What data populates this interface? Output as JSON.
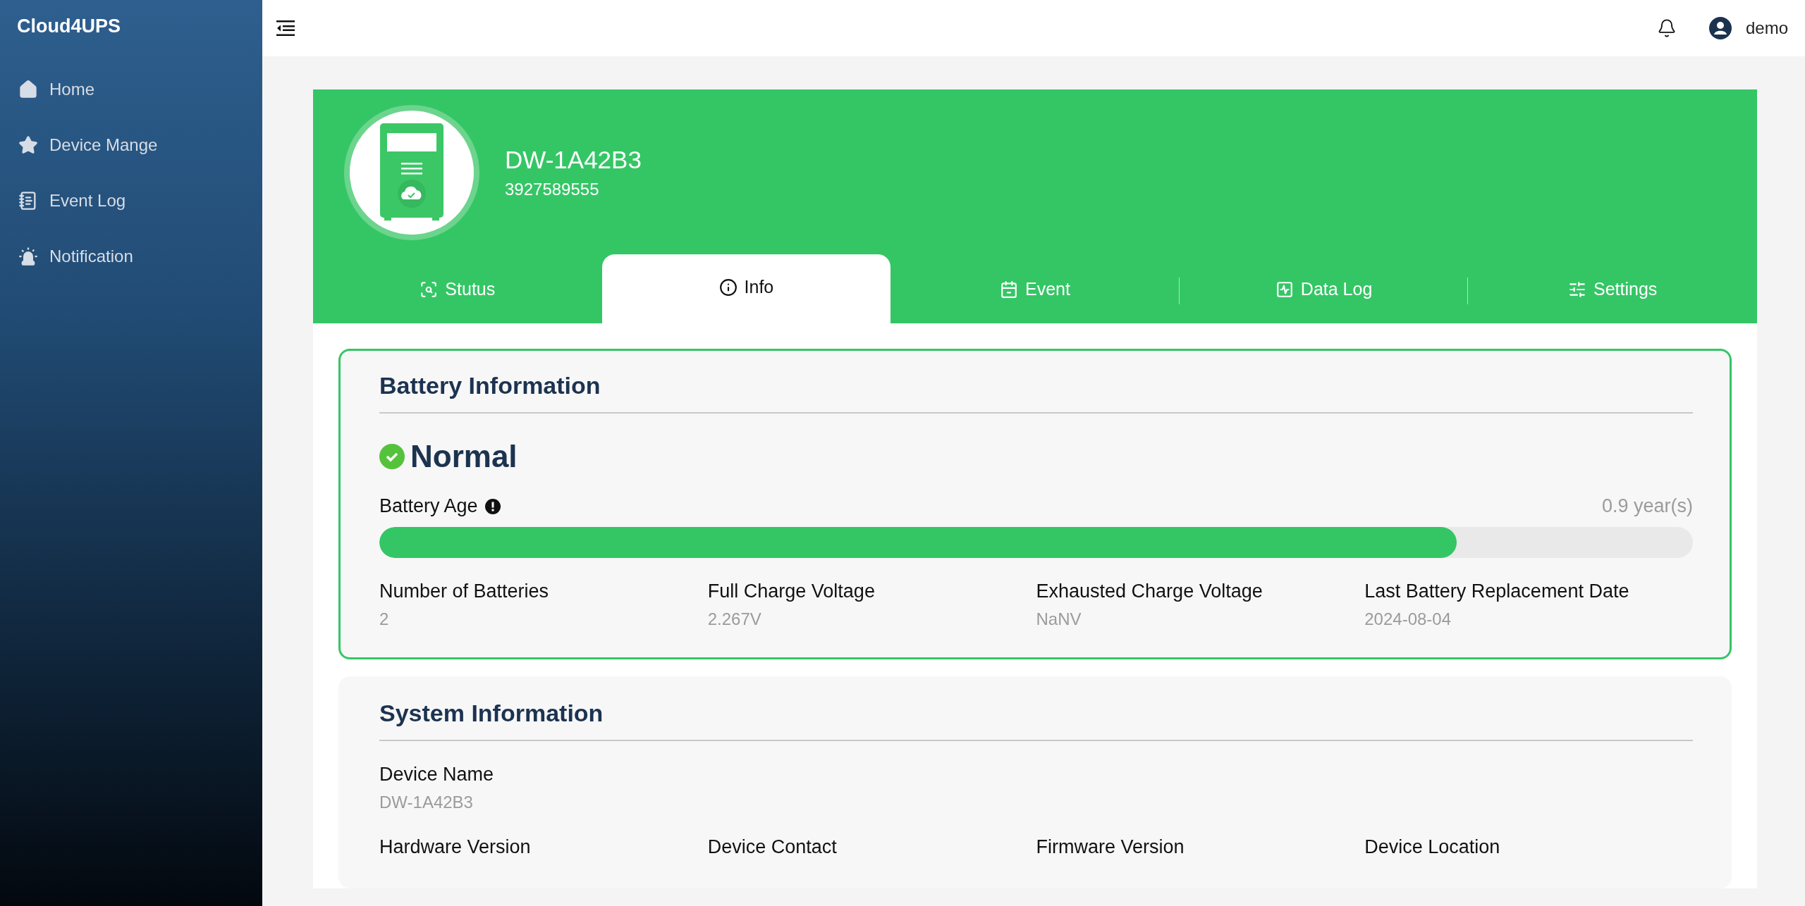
{
  "sidebar": {
    "brand": "Cloud4UPS",
    "items": [
      {
        "label": "Home",
        "kind": "home"
      },
      {
        "label": "Device Mange",
        "kind": "star"
      },
      {
        "label": "Event Log",
        "kind": "notepad"
      },
      {
        "label": "Notification",
        "kind": "alarm"
      }
    ]
  },
  "header": {
    "user": "demo"
  },
  "device": {
    "name": "DW-1A42B3",
    "serial": "3927589555"
  },
  "tabs": [
    {
      "label": "Stutus",
      "kind": "status",
      "selected": false
    },
    {
      "label": "Info",
      "kind": "info",
      "selected": true
    },
    {
      "label": "Event",
      "kind": "event",
      "selected": false
    },
    {
      "label": "Data Log",
      "kind": "chart",
      "selected": false
    },
    {
      "label": "Settings",
      "kind": "sliders",
      "selected": false
    }
  ],
  "battery": {
    "title": "Battery Information",
    "status": "Normal",
    "age_label": "Battery Age",
    "age_value": "0.9 year(s)",
    "level": 0.82,
    "fields": [
      {
        "label": "Number of Batteries",
        "value": "2"
      },
      {
        "label": "Full Charge Voltage",
        "value": "2.267V"
      },
      {
        "label": "Exhausted Charge Voltage",
        "value": "NaNV"
      },
      {
        "label": "Last Battery Replacement Date",
        "value": "2024-08-04"
      }
    ]
  },
  "system": {
    "title": "System Information",
    "rows": [
      [
        {
          "label": "Device Name",
          "value": "DW-1A42B3"
        }
      ],
      [
        {
          "label": "Hardware Version"
        },
        {
          "label": "Device Contact"
        },
        {
          "label": "Firmware Version"
        },
        {
          "label": "Device Location"
        }
      ]
    ]
  }
}
